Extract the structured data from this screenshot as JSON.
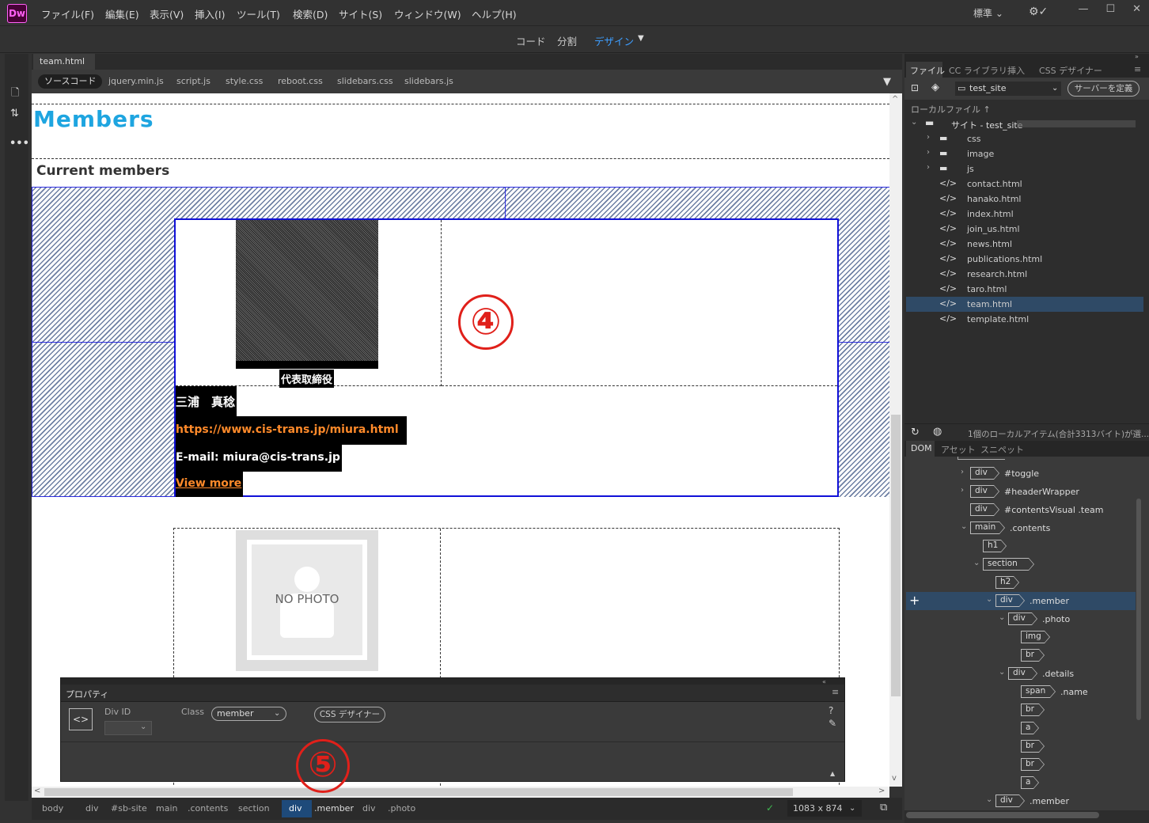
{
  "app": {
    "logo": "Dw"
  },
  "menu": [
    "ファイル(F)",
    "編集(E)",
    "表示(V)",
    "挿入(I)",
    "ツール(T)",
    "検索(D)",
    "サイト(S)",
    "ウィンドウ(W)",
    "ヘルプ(H)"
  ],
  "workspace": "標準",
  "views": {
    "code": "コード",
    "split": "分割",
    "design": "デザイン"
  },
  "document": {
    "tab": "team.html",
    "related": [
      "ソースコード",
      "jquery.min.js",
      "script.js",
      "style.css",
      "reboot.css",
      "slidebars.css",
      "slidebars.js"
    ]
  },
  "page": {
    "h1": "Members",
    "h2": "Current members",
    "member1": {
      "role": "代表取締役",
      "name": "三浦　真稔",
      "url": "https://www.cis-trans.jp/miura.html",
      "email": "E-mail: miura@cis-trans.jp",
      "more": "View more"
    },
    "member2": {
      "no_photo": "NO PHOTO"
    }
  },
  "annotations": {
    "a4": "④",
    "a5": "⑤"
  },
  "properties": {
    "title": "プロパティ",
    "div_id_label": "Div ID",
    "class_label": "Class",
    "class_value": "member",
    "css_designer": "CSS デザイナー"
  },
  "statusbar": {
    "crumbs": [
      "body",
      "div",
      "#sb-site",
      "main",
      ".contents",
      "section",
      "div",
      ".member",
      "div",
      ".photo"
    ],
    "size": "1083 x 874"
  },
  "files_panel": {
    "tabs": [
      "ファイル",
      "CC ライブラリ",
      "挿入",
      "CSS デザイナー"
    ],
    "site": "test_site",
    "define_server": "サーバーを定義",
    "local_files": "ローカルファイル ↑",
    "site_root": "サイト - test_site",
    "folders": [
      "css",
      "image",
      "js"
    ],
    "files": [
      "contact.html",
      "hanako.html",
      "index.html",
      "join_us.html",
      "news.html",
      "publications.html",
      "research.html",
      "taro.html",
      "team.html",
      "template.html"
    ],
    "selected": "team.html",
    "status": "1個のローカルアイテム(合計3313バイト)が選..."
  },
  "dom_panel": {
    "tabs": [
      "DOM",
      "アセット",
      "スニペット"
    ],
    "rows": [
      {
        "tag": "div",
        "label": "#toggle",
        "indent": 0
      },
      {
        "tag": "div",
        "label": "#headerWrapper",
        "indent": 0
      },
      {
        "tag": "div",
        "label": "#contentsVisual .team",
        "indent": 0
      },
      {
        "tag": "main",
        "label": ".contents",
        "indent": 0
      },
      {
        "tag": "h1",
        "label": "",
        "indent": 1
      },
      {
        "tag": "section",
        "label": "",
        "indent": 1
      },
      {
        "tag": "h2",
        "label": "",
        "indent": 2
      },
      {
        "tag": "div",
        "label": ".member",
        "indent": 2
      },
      {
        "tag": "div",
        "label": ".photo",
        "indent": 3
      },
      {
        "tag": "img",
        "label": "",
        "indent": 4
      },
      {
        "tag": "br",
        "label": "",
        "indent": 4
      },
      {
        "tag": "div",
        "label": ".details",
        "indent": 3
      },
      {
        "tag": "span",
        "label": ".name",
        "indent": 4
      },
      {
        "tag": "br",
        "label": "",
        "indent": 4
      },
      {
        "tag": "a",
        "label": "",
        "indent": 4
      },
      {
        "tag": "br",
        "label": "",
        "indent": 4
      },
      {
        "tag": "br",
        "label": "",
        "indent": 4
      },
      {
        "tag": "a",
        "label": "",
        "indent": 4
      },
      {
        "tag": "div",
        "label": ".member",
        "indent": 2
      }
    ]
  }
}
